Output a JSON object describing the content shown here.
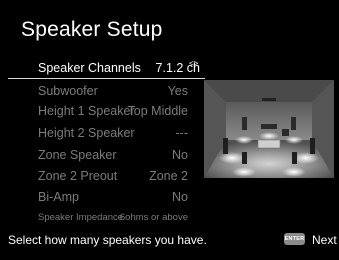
{
  "screen": {
    "title": "Speaker Setup"
  },
  "settings": [
    {
      "label": "Speaker Channels",
      "value": "7.1.2 ch"
    },
    {
      "label": "Subwoofer",
      "value": "Yes"
    },
    {
      "label": "Height 1 Speaker",
      "value": "Top Middle"
    },
    {
      "label": "Height 2 Speaker",
      "value": "---"
    },
    {
      "label": "Zone Speaker",
      "value": "No"
    },
    {
      "label": "Zone 2 Preout",
      "value": "Zone 2"
    },
    {
      "label": "Bi-Amp",
      "value": "No"
    },
    {
      "label": "Speaker Impedance",
      "value": "6ohms or above"
    }
  ],
  "selector": {
    "arrows": "<>"
  },
  "footer": {
    "help_text": "Select how many speakers you have.",
    "enter_label": "ENTER",
    "next_label": "Next"
  },
  "colors": {
    "background": "#000000",
    "active_text": "#ffffff",
    "inactive_text": "#7c7c7c",
    "enter_button": "#8a8a8a"
  },
  "icons": {
    "diagram": "speaker-layout-room"
  }
}
